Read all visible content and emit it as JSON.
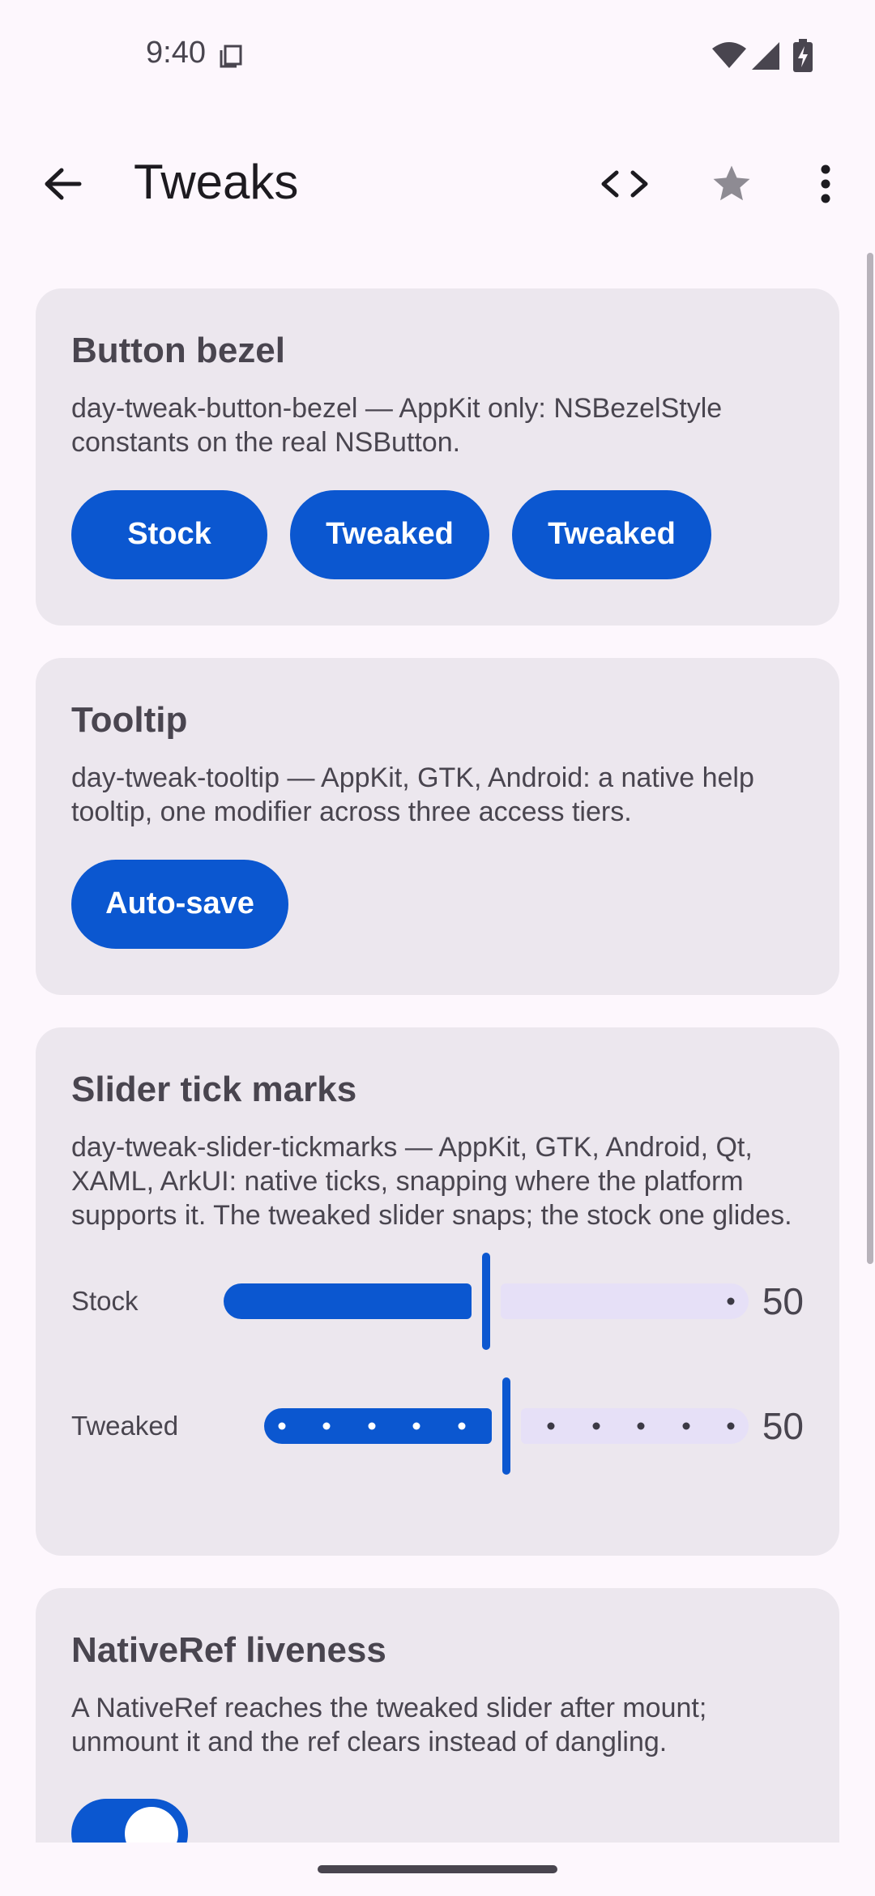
{
  "status_bar": {
    "time": "9:40"
  },
  "app_bar": {
    "title": "Tweaks"
  },
  "cards": {
    "button_bezel": {
      "title": "Button bezel",
      "description": "day-tweak-button-bezel — AppKit only: NSBezelStyle constants on the real NSButton.",
      "buttons": [
        "Stock",
        "Tweaked",
        "Tweaked"
      ]
    },
    "tooltip": {
      "title": "Tooltip",
      "description": "day-tweak-tooltip — AppKit, GTK, Android: a native help tooltip, one modifier across three access tiers.",
      "button": "Auto-save"
    },
    "slider_tick_marks": {
      "title": "Slider tick marks",
      "description": "day-tweak-slider-tickmarks — AppKit, GTK, Android, Qt, XAML, ArkUI: native ticks, snapping where the platform supports it. The tweaked slider snaps; the stock one glides.",
      "sliders": [
        {
          "label": "Stock",
          "value": "50",
          "fraction": 0.5,
          "ticks": 0
        },
        {
          "label": "Tweaked",
          "value": "50",
          "fraction": 0.5,
          "ticks": 11
        }
      ]
    },
    "nativeref_liveness": {
      "title": "NativeRef liveness",
      "description": "A NativeRef reaches the tweaked slider after mount; unmount it and the ref clears instead of dangling.",
      "switch_on": true
    }
  },
  "colors": {
    "primary": "#0b57d0",
    "card_bg": "#ece7ee",
    "page_bg": "#fdf7fd",
    "track_inactive": "#e6e0f7"
  }
}
